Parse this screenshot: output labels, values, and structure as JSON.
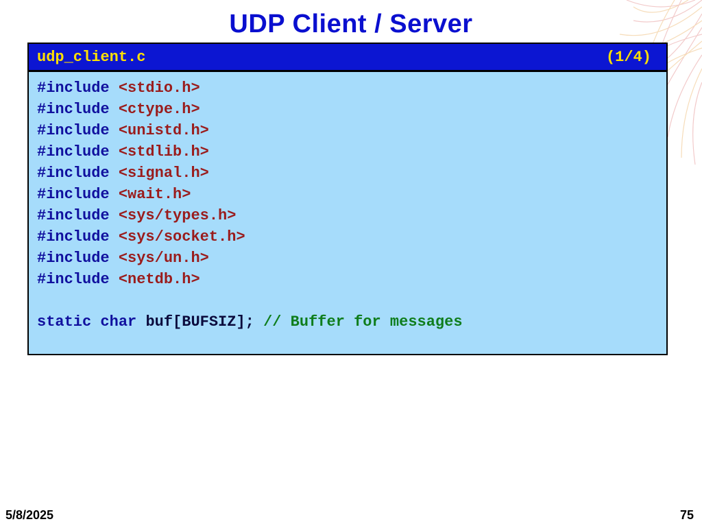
{
  "slide": {
    "title": "UDP Client / Server",
    "date": "5/8/2025",
    "page_number": "75"
  },
  "code_box": {
    "filename": "udp_client.c",
    "part": "(1/4)",
    "includes": [
      "<stdio.h>",
      "<ctype.h>",
      "<unistd.h>",
      "<stdlib.h>",
      "<signal.h>",
      "<wait.h>",
      "<sys/types.h>",
      "<sys/socket.h>",
      "<sys/un.h>",
      "<netdb.h>"
    ],
    "include_keyword": "#include",
    "decl": {
      "keywords": "static char",
      "identifier": "buf[BUFSIZ];",
      "comment": "// Buffer for messages"
    }
  },
  "colors": {
    "title": "#0a0fcf",
    "header_bg": "#0c16d2",
    "header_text": "#ffe000",
    "body_bg": "#a6dcfb",
    "keyword": "#10109e",
    "header_file": "#9a1c1c",
    "comment": "#0e7d1c"
  }
}
